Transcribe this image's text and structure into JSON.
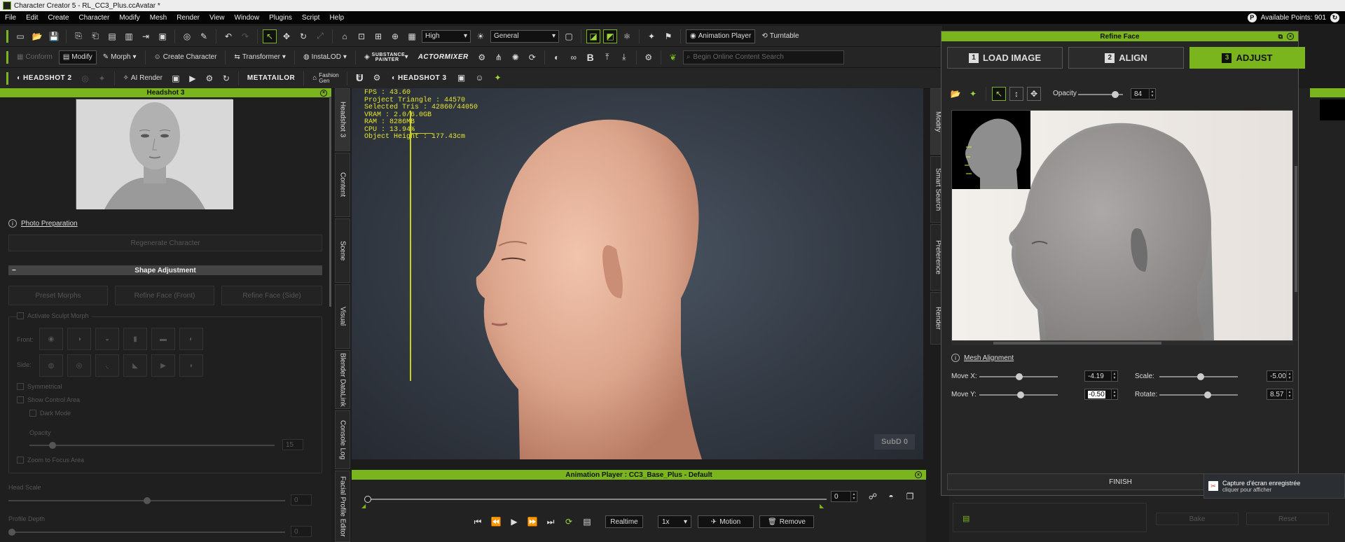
{
  "window": {
    "title": "Character Creator 5 - RL_CC3_Plus.ccAvatar *"
  },
  "menu": {
    "items": [
      "File",
      "Edit",
      "Create",
      "Character",
      "Modify",
      "Mesh",
      "Render",
      "View",
      "Window",
      "Plugins",
      "Script",
      "Help"
    ],
    "points_label": "Available Points: 901"
  },
  "toolbar1": {
    "quality": "High",
    "preset": "General",
    "animation_player": "Animation Player",
    "turntable": "Turntable"
  },
  "toolbar2": {
    "conform": "Conform",
    "modify": "Modify",
    "morph": "Morph",
    "create_character": "Create Character",
    "transformer": "Transformer",
    "instalod": "InstaLOD",
    "substance": "SUBSTANCE PAINTER",
    "actormixer": "ACTORMIXER",
    "search_placeholder": "Begin Online Content Search"
  },
  "toolbar3": {
    "headshot2": "HEADSHOT 2",
    "ai_render": "AI Render",
    "metatailor": "METATAILOR",
    "fashion_gen": "Fashion Gen",
    "headshot3": "HEADSHOT 3"
  },
  "left_panel": {
    "title": "Headshot 3",
    "photo_prep": "Photo Preparation",
    "regenerate": "Regenerate Character",
    "shape_adjustment": "Shape Adjustment",
    "preset_morphs": "Preset Morphs",
    "refine_front": "Refine Face (Front)",
    "refine_side": "Refine Face (Side)",
    "activate_sculpt": "Activate Sculpt Morph",
    "front": "Front:",
    "side": "Side:",
    "symmetrical": "Symmetrical",
    "show_control": "Show Control Area",
    "dark_mode": "Dark Mode",
    "opacity": "Opacity",
    "opacity_val": "15",
    "zoom": "Zoom to Focus Area",
    "head_scale": "Head Scale",
    "head_scale_val": "0",
    "profile_depth": "Profile Depth",
    "profile_depth_val": "0"
  },
  "vtabs": [
    "Headshot 3",
    "Content",
    "Scene",
    "Visual",
    "Blender DataLink",
    "Console Log",
    "Facial Profile Editor"
  ],
  "right_vtabs": [
    "Modify",
    "Smart Search",
    "Preference",
    "Render"
  ],
  "viewport": {
    "stats": [
      "FPS : 43.60",
      "Project Triangle : 44570",
      "Selected Tris : 42860/44050",
      "VRAM : 2.0/6.0GB",
      "RAM : 8286MB",
      "CPU : 13.94%",
      "Object Height : 177.43cm"
    ],
    "subd": "SubD 0"
  },
  "anim": {
    "title": "Animation Player : CC3_Base_Plus - Default",
    "frame": "0",
    "realtime": "Realtime",
    "speed": "1x",
    "motion": "Motion",
    "remove": "Remove",
    "progress": 0.0
  },
  "refine": {
    "title": "Refine Face",
    "step1": "LOAD IMAGE",
    "step1_n": "1",
    "step2": "ALIGN",
    "step2_n": "2",
    "step3": "ADJUST",
    "step3_n": "3",
    "opacity_label": "Opacity",
    "opacity_val": "84",
    "mesh_alignment": "Mesh Alignment",
    "move_x_label": "Move X:",
    "move_x": "-4.19",
    "move_y_label": "Move Y:",
    "move_y": "-0.50",
    "scale_label": "Scale:",
    "scale": "-5.00",
    "rotate_label": "Rotate:",
    "rotate": "8.57",
    "finish": "FINISH"
  },
  "behind": {
    "bake": "Bake",
    "reset": "Reset"
  },
  "notification": {
    "title": "Capture d'écran enregistrée",
    "sub": "cliquer pour afficher"
  },
  "colors": {
    "accent": "#7ab51d",
    "stats": "#e6e632"
  }
}
